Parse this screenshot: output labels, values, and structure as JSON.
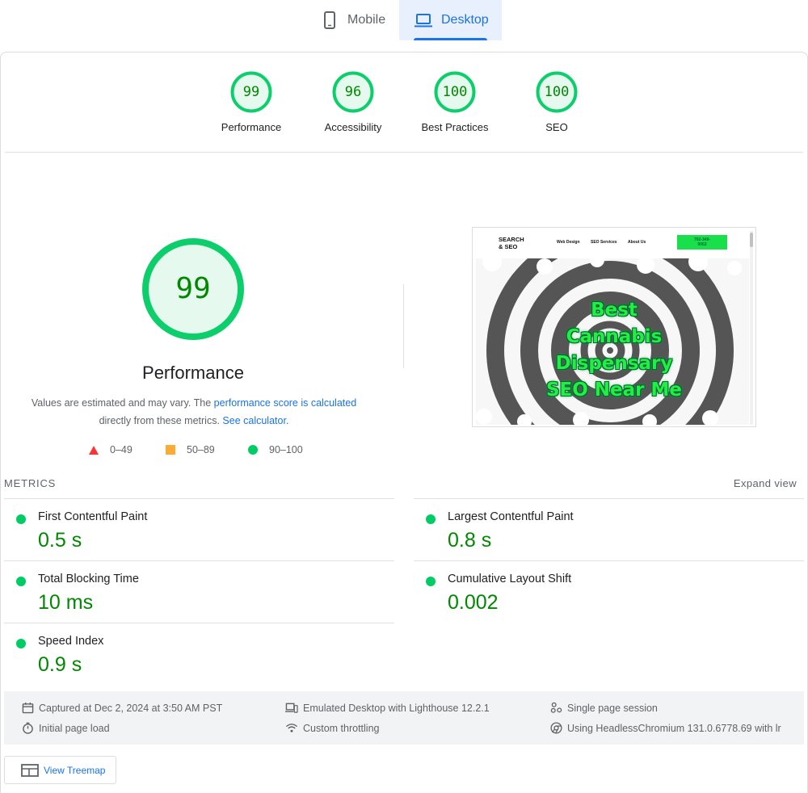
{
  "tabs": {
    "mobile": {
      "label": "Mobile"
    },
    "desktop": {
      "label": "Desktop",
      "selected": true
    }
  },
  "categories": [
    {
      "label": "Performance",
      "score": "99"
    },
    {
      "label": "Accessibility",
      "score": "96"
    },
    {
      "label": "Best Practices",
      "score": "100"
    },
    {
      "label": "SEO",
      "score": "100"
    }
  ],
  "performance": {
    "score": "99",
    "title": "Performance",
    "desc_part1": "Values are estimated and may vary. The",
    "desc_link1": "performance score is calculated",
    "desc_part2": "directly from these metrics.",
    "desc_link2": "See calculator."
  },
  "legend": {
    "fail": "0–49",
    "average": "50–89",
    "pass": "90–100"
  },
  "screenshot": {
    "logo_line1": "SEARCH",
    "logo_line2": "& SEO",
    "nav": [
      "Web Design",
      "SEO Services",
      "About Us"
    ],
    "phone_line1": "702-349-",
    "phone_line2": "0053",
    "headline": [
      "Best",
      "Cannabis",
      "Dispensary",
      "SEO Near Me"
    ]
  },
  "metrics": {
    "header": "METRICS",
    "expand": "Expand view",
    "fcp": {
      "name": "First Contentful Paint",
      "value": "0.5 s"
    },
    "lcp": {
      "name": "Largest Contentful Paint",
      "value": "0.8 s"
    },
    "tbt": {
      "name": "Total Blocking Time",
      "value": "10 ms"
    },
    "cls": {
      "name": "Cumulative Layout Shift",
      "value": "0.002"
    },
    "si": {
      "name": "Speed Index",
      "value": "0.9 s"
    }
  },
  "runtime": {
    "captured": "Captured at Dec 2, 2024 at 3:50 AM PST",
    "initial": "Initial page load",
    "emulated": "Emulated Desktop with Lighthouse 12.2.1",
    "throttling": "Custom throttling",
    "session": "Single page session",
    "browser": "Using HeadlessChromium 131.0.6778.69 with lr"
  },
  "treemap": {
    "label": "View Treemap"
  },
  "colors": {
    "pass": "#0cce6b",
    "pass_text": "#008800",
    "average": "#ffaa33",
    "fail": "#ff3333",
    "link": "#1a73e8"
  }
}
